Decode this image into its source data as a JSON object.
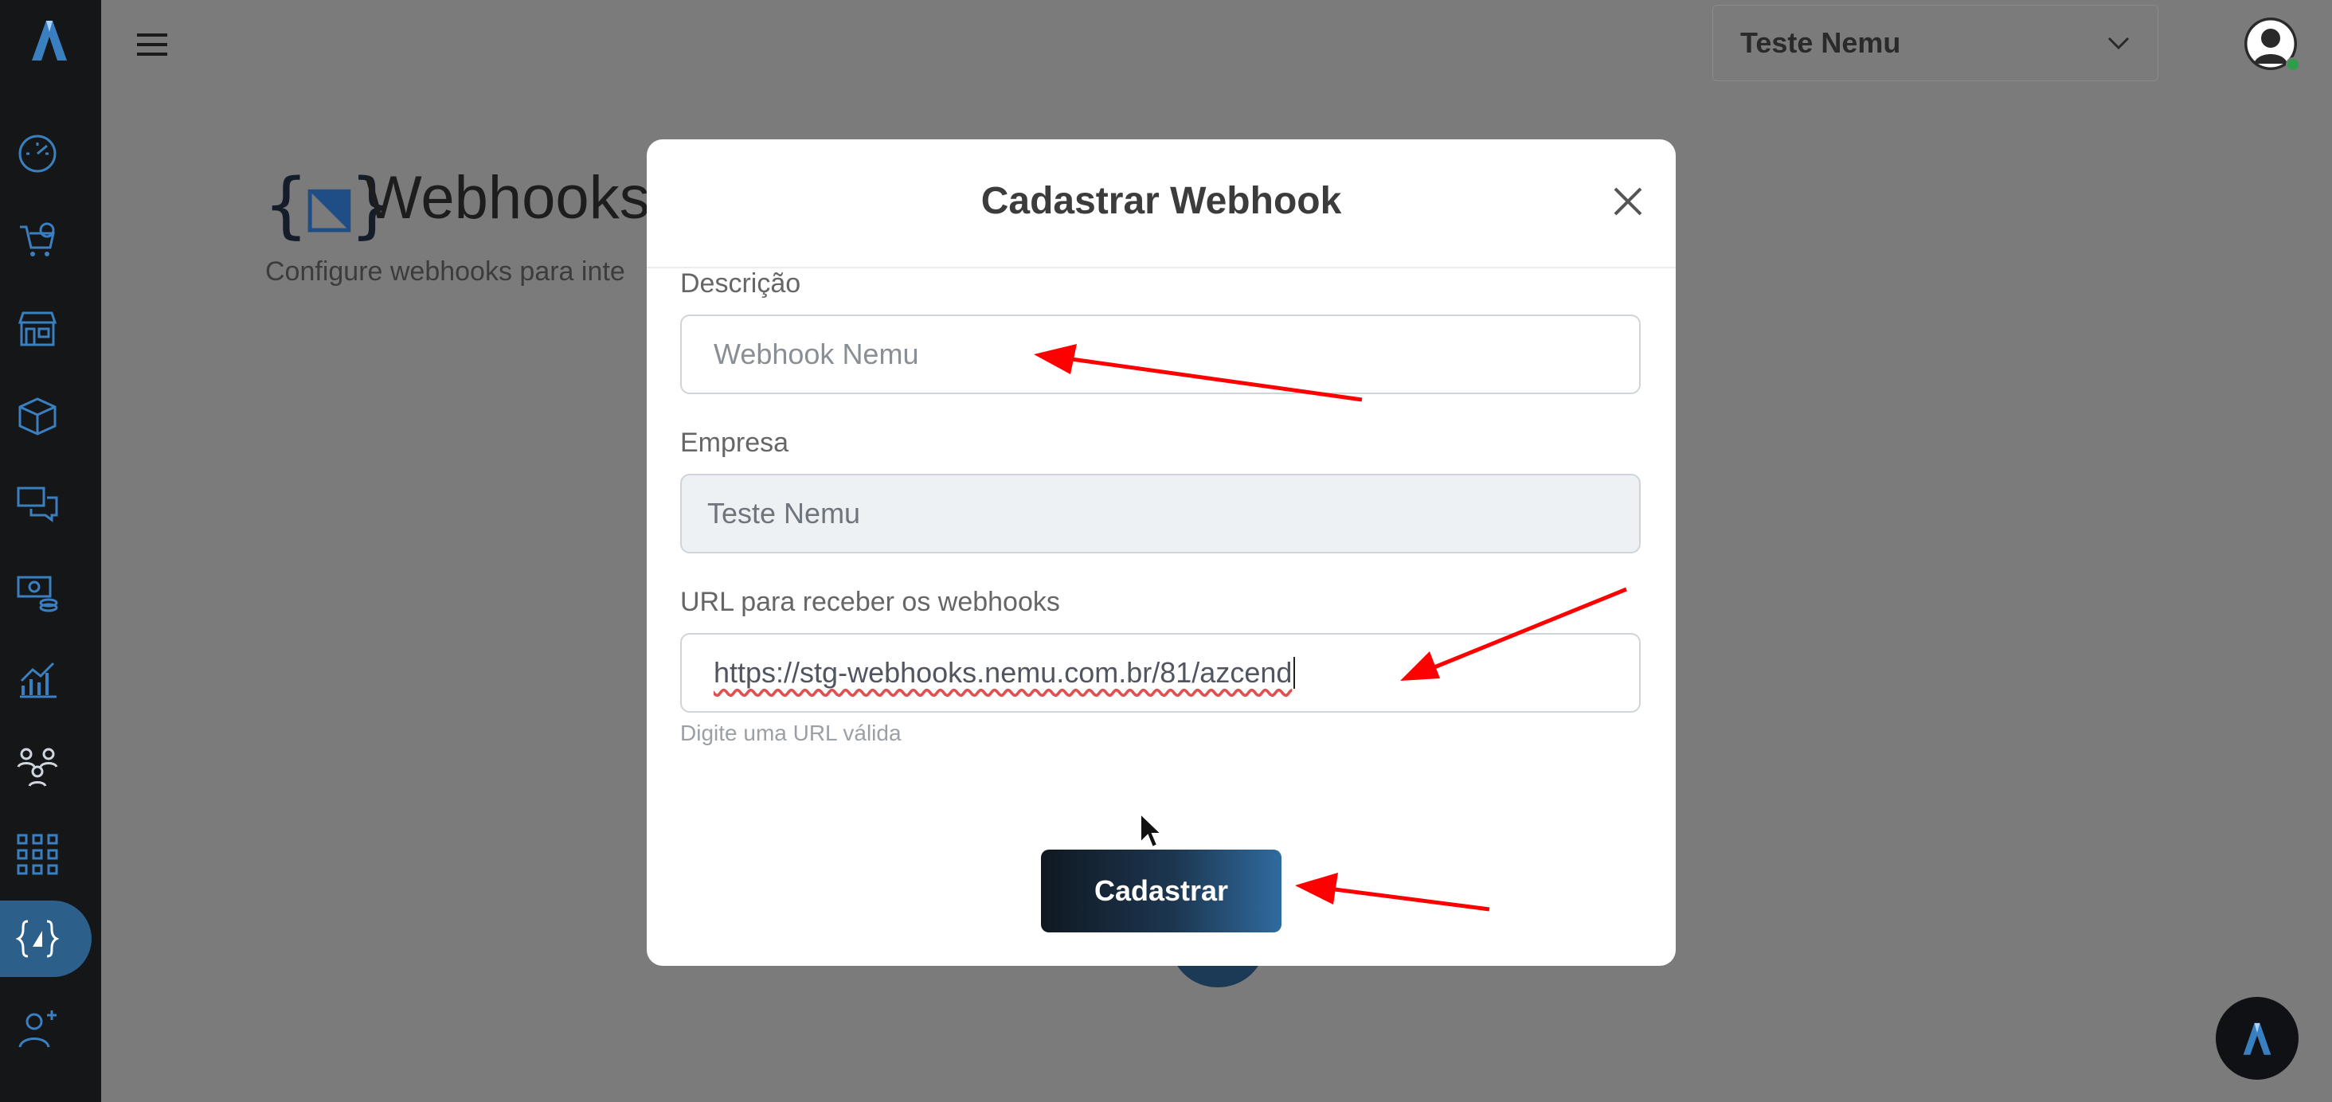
{
  "header": {
    "company_selected": "Teste Nemu"
  },
  "page": {
    "title": "Webhooks",
    "subtitle": "Configure webhooks para inte"
  },
  "sidebar": {
    "items": [
      {
        "icon": "dashboard-gauge-icon"
      },
      {
        "icon": "shopping-cart-check-icon"
      },
      {
        "icon": "storefront-icon"
      },
      {
        "icon": "package-box-icon"
      },
      {
        "icon": "chat-bubbles-icon"
      },
      {
        "icon": "money-bill-icon"
      },
      {
        "icon": "growth-chart-icon"
      },
      {
        "icon": "team-users-icon"
      },
      {
        "icon": "apps-grid-icon"
      },
      {
        "icon": "webhooks-braces-icon",
        "active": true
      },
      {
        "icon": "add-user-icon"
      }
    ]
  },
  "modal": {
    "title": "Cadastrar Webhook",
    "fields": {
      "description": {
        "label": "Descrição",
        "placeholder": "Webhook Nemu"
      },
      "company": {
        "label": "Empresa",
        "value": "Teste Nemu"
      },
      "url": {
        "label": "URL para receber os webhooks",
        "value": "https://stg-webhooks.nemu.com.br/81/azcend",
        "hint": "Digite uma URL válida"
      }
    },
    "submit_label": "Cadastrar"
  },
  "colors": {
    "sidebar_bg": "#141617",
    "accent": "#2c5f8a",
    "annotation_arrow": "#ff0000"
  }
}
